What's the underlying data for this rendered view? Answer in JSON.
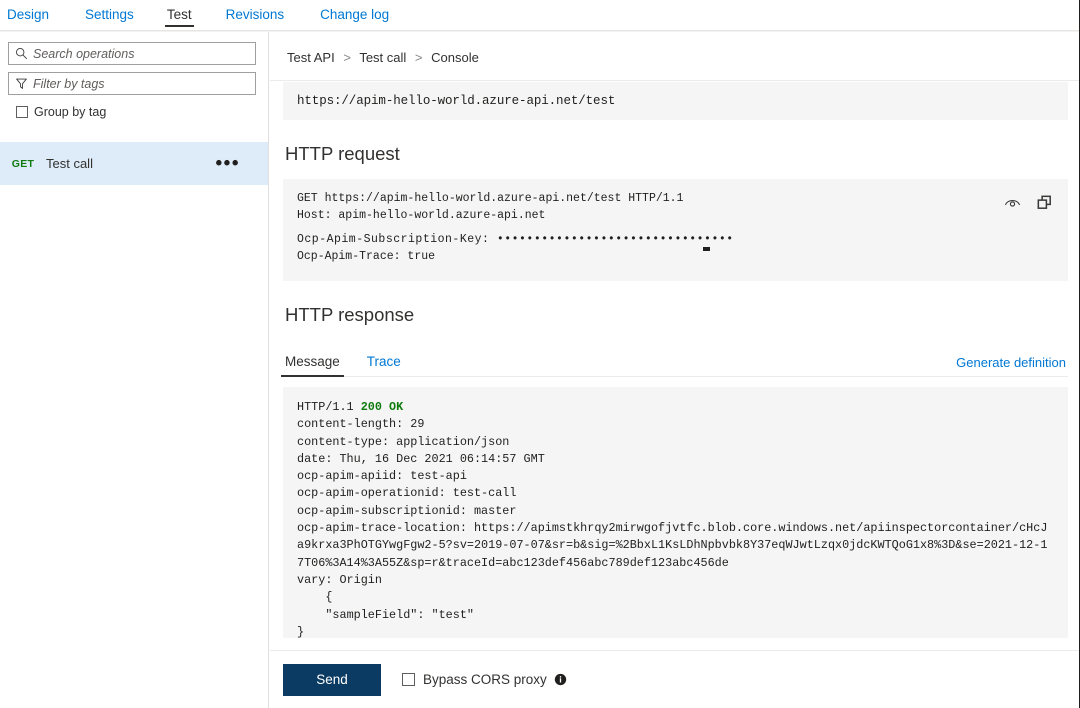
{
  "topnav": {
    "tabs": [
      {
        "label": "Design",
        "active": false
      },
      {
        "label": "Settings",
        "active": false
      },
      {
        "label": "Test",
        "active": true
      },
      {
        "label": "Revisions",
        "active": false
      },
      {
        "label": "Change log",
        "active": false
      }
    ]
  },
  "sidebar": {
    "search_placeholder": "Search operations",
    "search_value": "",
    "filter_placeholder": "Filter by tags",
    "filter_value": "",
    "group_by_tag_label": "Group by tag",
    "group_by_tag_checked": false,
    "operations": [
      {
        "method": "GET",
        "name": "Test call",
        "menu": "•••",
        "selected": true
      }
    ]
  },
  "breadcrumb": {
    "items": [
      "Test API",
      "Test call",
      "Console"
    ],
    "separator": ">"
  },
  "url_bar": {
    "value": "https://apim-hello-world.azure-api.net/test"
  },
  "request": {
    "title": "HTTP request",
    "line1": "GET https://apim-hello-world.azure-api.net/test HTTP/1.1",
    "line2": "Host: apim-hello-world.azure-api.net",
    "line3": "Ocp-Apim-Subscription-Key: ••••••••••••••••••••••••••••••••",
    "line4": "Ocp-Apim-Trace: true",
    "reveal_icon": "eye-icon",
    "copy_icon": "copy-icon"
  },
  "response": {
    "title": "HTTP response",
    "tabs": [
      {
        "label": "Message",
        "active": true
      },
      {
        "label": "Trace",
        "active": false
      }
    ],
    "generate_definition_label": "Generate definition",
    "status_prefix": "HTTP/1.1 ",
    "status_code": "200 OK",
    "headers": "content-length: 29\ncontent-type: application/json\ndate: Thu, 16 Dec 2021 06:14:57 GMT\nocp-apim-apiid: test-api\nocp-apim-operationid: test-call\nocp-apim-subscriptionid: master\nocp-apim-trace-location: https://apimstkhrqy2mirwgofjvtfc.blob.core.windows.net/apiinspectorcontainer/cHcJa9krxa3PhOTGYwgFgw2-5?sv=2019-07-07&sr=b&sig=%2BbxL1KsLDhNpbvbk8Y37eqWJwtLzqx0jdcKWTQoG1x8%3D&se=2021-12-17T06%3A14%3A55Z&sp=r&traceId=abc123def456abc789def123abc456de\nvary: Origin",
    "body": "    {\n    \"sampleField\": \"test\"\n}"
  },
  "footer": {
    "send_label": "Send",
    "bypass_label": "Bypass CORS proxy",
    "bypass_checked": false,
    "info_icon": "info-icon"
  },
  "colors": {
    "link": "#0078d4",
    "accent_button": "#0b3b63",
    "method_get": "#107c10",
    "status_ok": "#107c10",
    "selected_row": "#deecf9",
    "code_bg": "#f5f5f5"
  }
}
